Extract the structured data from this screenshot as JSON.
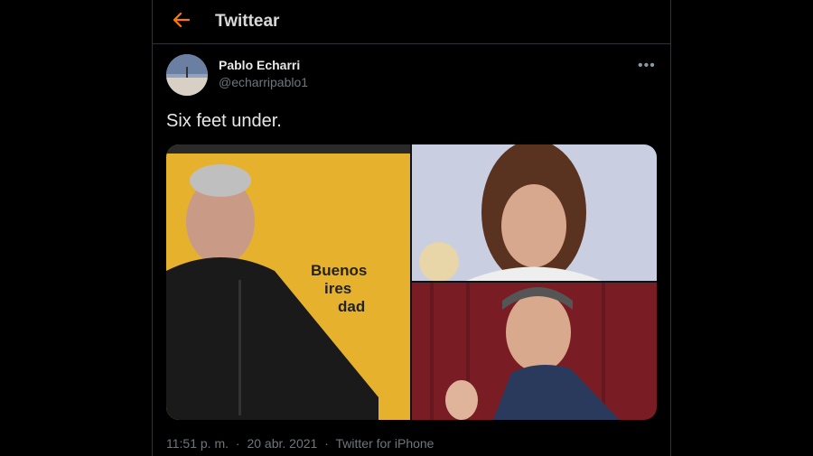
{
  "header": {
    "title": "Twittear",
    "back_icon": "arrow-left-icon"
  },
  "tweet": {
    "display_name": "Pablo Echarri",
    "handle": "@echarripablo1",
    "text": "Six feet under.",
    "time": "11:51 p. m.",
    "separator": "·",
    "date": "20 abr. 2021",
    "source": "Twitter for iPhone",
    "more_icon": "more-icon",
    "more_glyph": "•••"
  },
  "media": {
    "left_image_text": [
      "Buenos",
      "ires",
      "dad"
    ]
  },
  "colors": {
    "accent": "#ff7a00",
    "background": "#000000",
    "border": "#2f3336",
    "muted": "#6e767d"
  }
}
